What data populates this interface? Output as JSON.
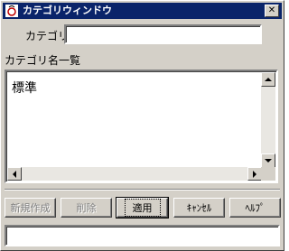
{
  "window": {
    "title": "カテゴリウィンドウ",
    "close_glyph": "✕"
  },
  "form": {
    "name_label": "カテゴリ名",
    "name_value": "",
    "list_label": "カテゴリ名一覧",
    "list_items": [
      "標準"
    ]
  },
  "buttons": {
    "new": "新規作成",
    "delete": "削除",
    "apply": "適用",
    "cancel": "ｷｬﾝｾﾙ",
    "help": "ﾍﾙﾌﾟ"
  },
  "status": {
    "text": ""
  },
  "colors": {
    "titlebar": "#0a246a",
    "face": "#d4d0c8"
  }
}
